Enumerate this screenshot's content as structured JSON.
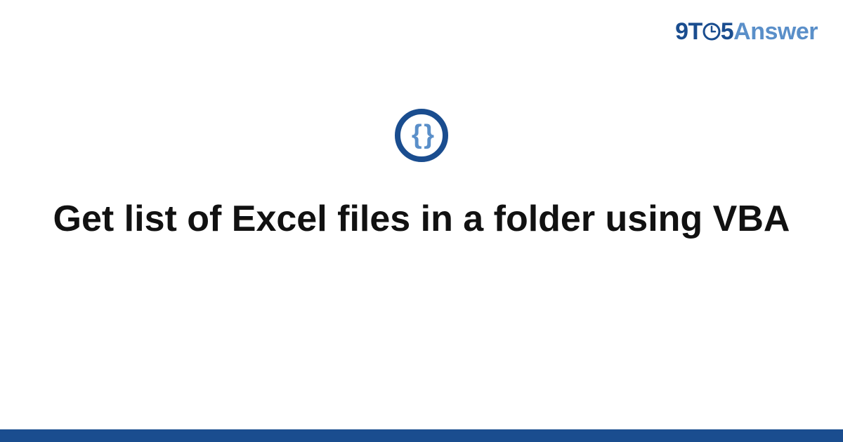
{
  "header": {
    "logo_part1": "9T",
    "logo_part2": "5",
    "logo_part3": "Answer"
  },
  "icon": {
    "braces": "{ }"
  },
  "title": "Get list of Excel files in a folder using VBA",
  "colors": {
    "primary": "#1a4d8f",
    "secondary": "#5a8fc9"
  }
}
